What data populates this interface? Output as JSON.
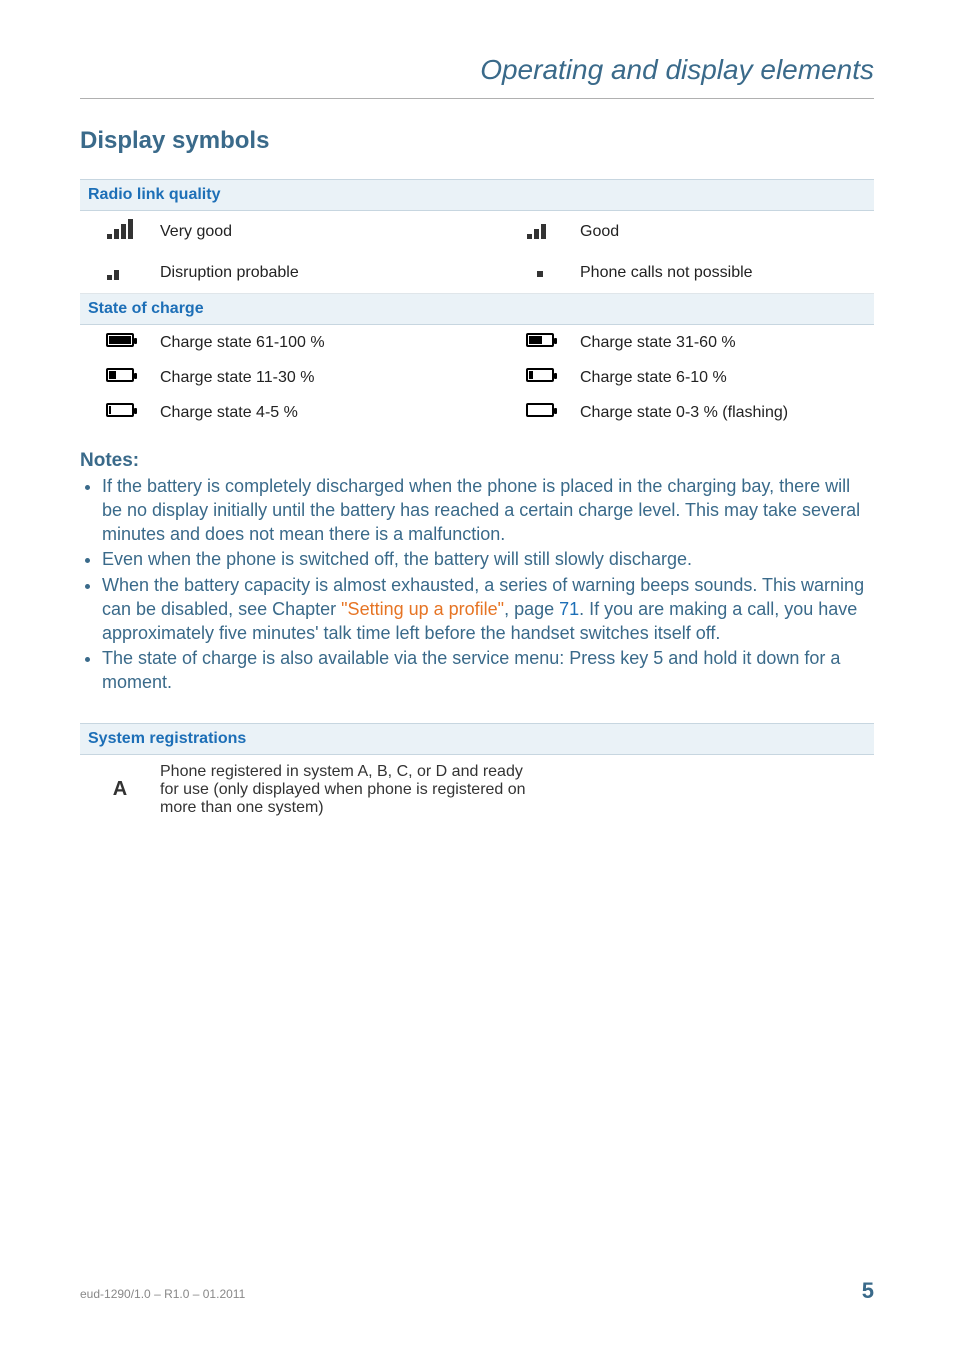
{
  "header": {
    "section_title": "Operating and display elements"
  },
  "h2": "Display symbols",
  "tables": {
    "radio": {
      "heading": "Radio link quality",
      "rows": [
        {
          "l_label": "Very good",
          "r_label": "Good"
        },
        {
          "l_label": "Disruption probable",
          "r_label": "Phone calls not possible"
        }
      ]
    },
    "charge": {
      "heading": "State of charge",
      "rows": [
        {
          "l_label": "Charge state 61-100 %",
          "r_label": "Charge state 31-60 %"
        },
        {
          "l_label": "Charge state 11-30 %",
          "r_label": "Charge state 6-10 %"
        },
        {
          "l_label": "Charge state 4-5 %",
          "r_label": "Charge state 0-3 % (flashing)"
        }
      ]
    },
    "sysreg": {
      "heading": "System registrations",
      "icon_label": "A",
      "desc": "Phone registered in system A, B, C, or D and ready for use (only displayed when phone is registered on more than one system)"
    }
  },
  "notes": {
    "title": "Notes:",
    "items": [
      {
        "text": "If the battery is completely discharged when the phone is placed in the charging bay, there will be no display initially until the battery has reached a certain charge level. This may take several minutes and does not mean there is a malfunction."
      },
      {
        "text": "Even when the phone is switched off, the battery will still slowly discharge."
      },
      {
        "pre": "When the battery capacity is almost exhausted, a series of warning beeps sounds. This warning can be disabled, see Chapter ",
        "link": "\"Setting up a profile\"",
        "mid": ", page ",
        "page": "71",
        "post": ". If you are making a call, you have approximately five minutes' talk time left before the handset switches itself off."
      },
      {
        "text": "The state of charge is also available via the service menu: Press key 5 and hold it down for a moment."
      }
    ]
  },
  "footer": {
    "left": "eud-1290/1.0 – R1.0 – 01.2011",
    "page": "5"
  }
}
